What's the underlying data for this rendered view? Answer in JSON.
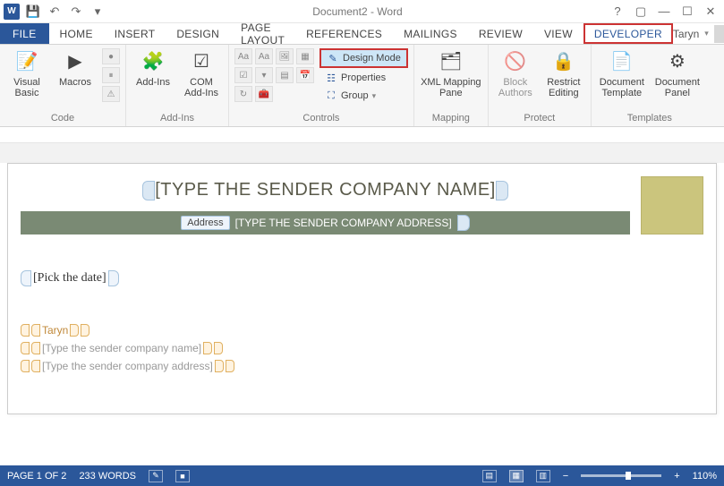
{
  "titlebar": {
    "title": "Document2 - Word"
  },
  "tabs": {
    "file": "FILE",
    "home": "HOME",
    "insert": "INSERT",
    "design": "DESIGN",
    "page_layout": "PAGE LAYOUT",
    "references": "REFERENCES",
    "mailings": "MAILINGS",
    "review": "REVIEW",
    "view": "VIEW",
    "developer": "DEVELOPER"
  },
  "user": {
    "name": "Taryn"
  },
  "ribbon": {
    "code": {
      "label": "Code",
      "visual_basic": "Visual Basic",
      "macros": "Macros"
    },
    "addins": {
      "label": "Add-Ins",
      "addins_btn": "Add-Ins",
      "com_addins": "COM Add-Ins"
    },
    "controls": {
      "label": "Controls",
      "design_mode": "Design Mode",
      "properties": "Properties",
      "group": "Group"
    },
    "mapping": {
      "label": "Mapping",
      "xml_pane": "XML Mapping Pane"
    },
    "protect": {
      "label": "Protect",
      "block_authors": "Block Authors",
      "restrict_editing": "Restrict Editing"
    },
    "templates": {
      "label": "Templates",
      "doc_template": "Document Template",
      "doc_panel": "Document Panel"
    }
  },
  "doc": {
    "company_name_ph": "[TYPE THE SENDER COMPANY NAME]",
    "address_label": "Address",
    "address_ph": "[TYPE THE SENDER COMPANY ADDRESS]",
    "date_ph": "[Pick the date]",
    "sender_name": "Taryn",
    "sender_company_ph": "[Type the sender company name]",
    "sender_address_ph": "[Type the sender company address]"
  },
  "status": {
    "page": "PAGE 1 OF 2",
    "words": "233 WORDS",
    "zoom": "110%"
  }
}
